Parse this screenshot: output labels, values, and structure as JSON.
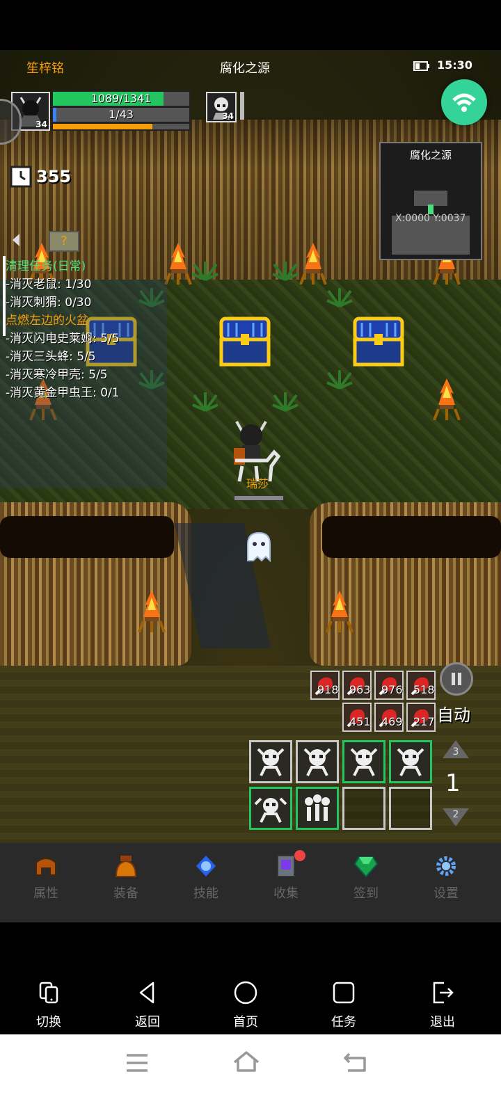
{
  "header": {
    "player_name": "笙梓铭",
    "map_title": "腐化之源",
    "time": "15:30"
  },
  "player": {
    "level": "34",
    "hp_text": "1089/1341",
    "hp_ratio": 0.812,
    "mp_text": "1/43",
    "mp_ratio": 0.023,
    "xp_ratio": 0.73
  },
  "target": {
    "level": "34"
  },
  "timer": {
    "value": "355"
  },
  "minimap": {
    "title": "腐化之源",
    "coords": "X:0000  Y:0037"
  },
  "quest": {
    "groups": [
      {
        "title": "清理任务(日常)",
        "lines": [
          "-消灭老鼠: 1/30",
          "-消灭刺猬: 0/30"
        ]
      },
      {
        "title": "点燃左边的火盆",
        "lines": [
          "-消灭闪电史莱姆: 5/5",
          "-消灭三头蜂: 5/5",
          "-消灭寒冷甲壳: 5/5",
          "-消灭黄金甲虫王: 0/1"
        ]
      }
    ]
  },
  "scene": {
    "npc_name": "瑞莎"
  },
  "loot": {
    "row1": [
      "918",
      "963",
      "976",
      "518"
    ],
    "row2": [
      "451",
      "469",
      "217"
    ]
  },
  "controls": {
    "auto_label": "自动",
    "floor_up": "3",
    "floor_current": "1",
    "floor_down": "2"
  },
  "menu": {
    "items": [
      {
        "label": "属性",
        "icon": "helmet-icon"
      },
      {
        "label": "装备",
        "icon": "bag-icon"
      },
      {
        "label": "技能",
        "icon": "skill-orb-icon"
      },
      {
        "label": "收集",
        "icon": "book-icon"
      },
      {
        "label": "签到",
        "icon": "emerald-icon"
      },
      {
        "label": "设置",
        "icon": "gear-icon"
      }
    ]
  },
  "nav": {
    "items": [
      {
        "label": "切换"
      },
      {
        "label": "返回"
      },
      {
        "label": "首页"
      },
      {
        "label": "任务"
      },
      {
        "label": "退出"
      }
    ]
  },
  "colors": {
    "hp": "#22c55e",
    "mp": "#3b82f6",
    "xp": "#f59e0b",
    "quest_daily": "#4ade80",
    "quest_main": "#f59e0b",
    "wifi_button": "#34d399",
    "notify_dot": "#ef4444"
  }
}
